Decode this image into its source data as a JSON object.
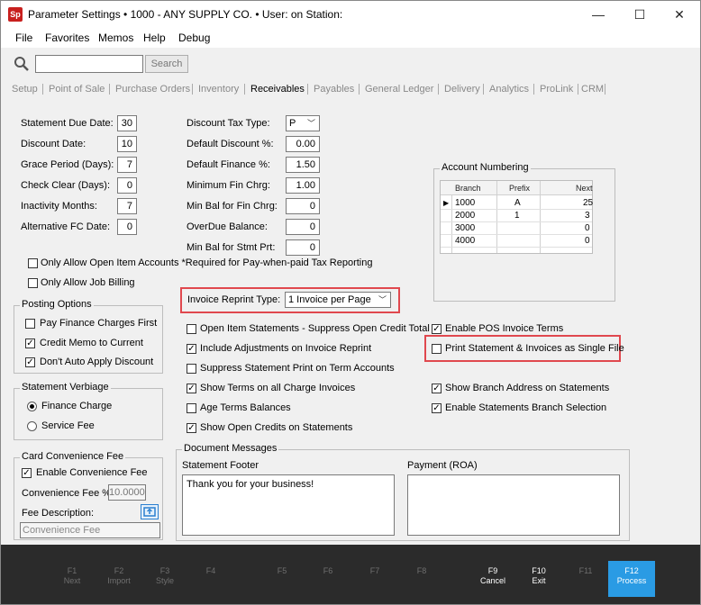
{
  "window": {
    "title": "Parameter Settings  •  1000 - ANY SUPPLY CO.  •  User:               on Station:",
    "app_icon": "Sp",
    "controls": {
      "minimize": "—",
      "maximize": "☐",
      "close": "✕"
    }
  },
  "menu": [
    "File",
    "Favorites",
    "Memos",
    "Help",
    "Debug"
  ],
  "search": {
    "value": "",
    "button": "Search"
  },
  "tabs": [
    "Setup",
    "Point of Sale",
    "Purchase Orders",
    "Inventory",
    "Receivables",
    "Payables",
    "General Ledger",
    "Delivery",
    "Analytics",
    "ProLink",
    "CRM"
  ],
  "active_tab": "Receivables",
  "left_fields": [
    {
      "label": "Statement Due Date:",
      "value": "30"
    },
    {
      "label": "Discount Date:",
      "value": "10"
    },
    {
      "label": "Grace Period (Days):",
      "value": "7"
    },
    {
      "label": "Check Clear (Days):",
      "value": "0"
    },
    {
      "label": "Inactivity Months:",
      "value": "7"
    },
    {
      "label": "Alternative FC Date:",
      "value": "0"
    }
  ],
  "mid_fields": {
    "discount_tax_type": {
      "label": "Discount Tax Type:",
      "value": "P"
    },
    "items": [
      {
        "label": "Default Discount %:",
        "value": "0.00"
      },
      {
        "label": "Default Finance %:",
        "value": "1.50"
      },
      {
        "label": "Minimum Fin Chrg:",
        "value": "1.00"
      },
      {
        "label": "Min Bal for Fin Chrg:",
        "value": "0"
      },
      {
        "label": "OverDue Balance:",
        "value": "0"
      },
      {
        "label": "Min Bal for Stmt Prt:",
        "value": "0"
      }
    ]
  },
  "account_numbering": {
    "title": "Account Numbering",
    "headers": [
      "Branch",
      "Prefix",
      "Next"
    ],
    "rows": [
      {
        "branch": "1000",
        "prefix": "A",
        "next": "25"
      },
      {
        "branch": "2000",
        "prefix": "1",
        "next": "3"
      },
      {
        "branch": "3000",
        "prefix": "",
        "next": "0"
      },
      {
        "branch": "4000",
        "prefix": "",
        "next": "0"
      }
    ],
    "row_pointer": "▶"
  },
  "checks_top": [
    {
      "label": "Only Allow Open Item Accounts *Required for Pay-when-paid Tax Reporting",
      "checked": false
    },
    {
      "label": "Only Allow Job Billing",
      "checked": false
    }
  ],
  "posting_options": {
    "title": "Posting Options",
    "items": [
      {
        "label": "Pay Finance Charges First",
        "checked": false
      },
      {
        "label": "Credit Memo to Current",
        "checked": true
      },
      {
        "label": "Don't Auto Apply Discount",
        "checked": true
      }
    ]
  },
  "invoice_reprint": {
    "label": "Invoice Reprint Type:",
    "value": "1 Invoice per Page"
  },
  "mid_checks": [
    {
      "label": "Open Item Statements - Suppress Open Credit Total",
      "checked": false
    },
    {
      "label": "Include Adjustments on Invoice Reprint",
      "checked": true
    },
    {
      "label": "Suppress Statement Print on Term Accounts",
      "checked": false
    },
    {
      "label": "Show Terms on all Charge Invoices",
      "checked": true
    },
    {
      "label": "Age Terms Balances",
      "checked": false
    },
    {
      "label": "Show Open Credits on Statements",
      "checked": true
    }
  ],
  "right_checks": [
    {
      "label": "Enable POS Invoice Terms",
      "checked": true
    },
    {
      "label": "Print Statement & Invoices as Single File",
      "checked": false
    },
    {
      "label": "Show Branch Address on Statements",
      "checked": true
    },
    {
      "label": "Enable Statements Branch Selection",
      "checked": true
    }
  ],
  "statement_verbiage": {
    "title": "Statement Verbiage",
    "options": [
      {
        "label": "Finance Charge",
        "selected": true
      },
      {
        "label": "Service Fee",
        "selected": false
      }
    ]
  },
  "card_fee": {
    "title": "Card Convenience Fee",
    "enable_label": "Enable Convenience Fee",
    "enabled": true,
    "fee_label": "Convenience Fee %:",
    "fee_value": "10.0000",
    "desc_label": "Fee Description:",
    "desc_value": "Convenience Fee"
  },
  "document_messages": {
    "title": "Document Messages",
    "statement_footer_label": "Statement Footer",
    "statement_footer_value": "Thank you for your business!",
    "payment_label": "Payment (ROA)",
    "payment_value": ""
  },
  "fkeys": [
    {
      "key": "F1",
      "label": "Next",
      "enabled": false
    },
    {
      "key": "F2",
      "label": "Import",
      "enabled": false
    },
    {
      "key": "F3",
      "label": "Style",
      "enabled": false
    },
    {
      "key": "F4",
      "label": "",
      "enabled": false
    },
    {
      "key": "F5",
      "label": "",
      "enabled": false
    },
    {
      "key": "F6",
      "label": "",
      "enabled": false
    },
    {
      "key": "F7",
      "label": "",
      "enabled": false
    },
    {
      "key": "F8",
      "label": "",
      "enabled": false
    },
    {
      "key": "F9",
      "label": "Cancel",
      "enabled": true
    },
    {
      "key": "F10",
      "label": "Exit",
      "enabled": true
    },
    {
      "key": "F11",
      "label": "",
      "enabled": false
    },
    {
      "key": "F12",
      "label": "Process",
      "enabled": true
    }
  ],
  "colors": {
    "highlight": "#e0484e",
    "process": "#2a9be4",
    "footer": "#2b2b2b"
  }
}
